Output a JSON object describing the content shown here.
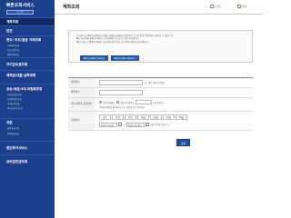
{
  "sidebar": {
    "title": "빠른조회서비스",
    "button": "로그인",
    "items": [
      {
        "label": "계좌조회",
        "active": true,
        "subs": []
      },
      {
        "label": "환전",
        "subs": []
      },
      {
        "label": "펀드/ 카드/출금 거래조회",
        "subs": [
          "거래내역조회",
          "카드이용조회",
          "외환거래조회"
        ]
      },
      {
        "label": "자기앞수표조회",
        "subs": []
      },
      {
        "label": "예적금/대출 납부조회",
        "subs": []
      },
      {
        "label": "공공/세금/4대 보험료조회",
        "subs": [
          "공과금납부조회",
          "지방세납부조회",
          "국세납부조회",
          "4대보험납부조회"
        ]
      },
      {
        "label": "외환",
        "subs": [
          "외화송금조회",
          "외화예금조회"
        ]
      },
      {
        "label": "법인부가서비스",
        "subs": []
      },
      {
        "label": "공무원연금조회",
        "subs": []
      }
    ]
  },
  "header": {
    "title": "계좌조회",
    "print": "프린트",
    "save": "저장"
  },
  "notice": {
    "lines": [
      "본 서비스는 빠른조회계좌로 등록된 계좌에 대하여 공인인증서 로그인 없이 간편하게 조회하실 수 있습니다.",
      "빠른조회 계좌 등록 및 해지는 인터넷뱅킹 로그인 후 이용 가능합니다.",
      "빠른조회는 본인명의 계좌만 가능하며 통장 분실 시 보안에 유의하시기 바랍니다."
    ],
    "buttons": [
      "빠른조회계좌 등록하기",
      "빠른조회계좌 해지하기"
    ]
  },
  "form": {
    "account_label": "계좌번호",
    "account_hint": "('-' 없이 숫자만 입력)",
    "password_label": "비밀번호",
    "id_label": "주민/사업자 등록번호",
    "id_hint": "( 앞 6자리 )",
    "id_options": [
      "주민등록번호",
      "사업자등록번호"
    ],
    "id_note": "(주민등록번호 앞 6자리 또는 사업자번호 10자리)",
    "period_label": "조회기간",
    "period_buttons": [
      "당일",
      "1주일",
      "15일",
      "1개월",
      "2개월",
      "3개월",
      "6개월"
    ],
    "from_date": "2016-03-06",
    "to_date": "2016-03-06",
    "date_note": "(최대 3개월 조회가능)",
    "search_button": "조회"
  },
  "colors": {
    "sidebar": "#1b3f8b",
    "accent": "#2a5db0"
  }
}
